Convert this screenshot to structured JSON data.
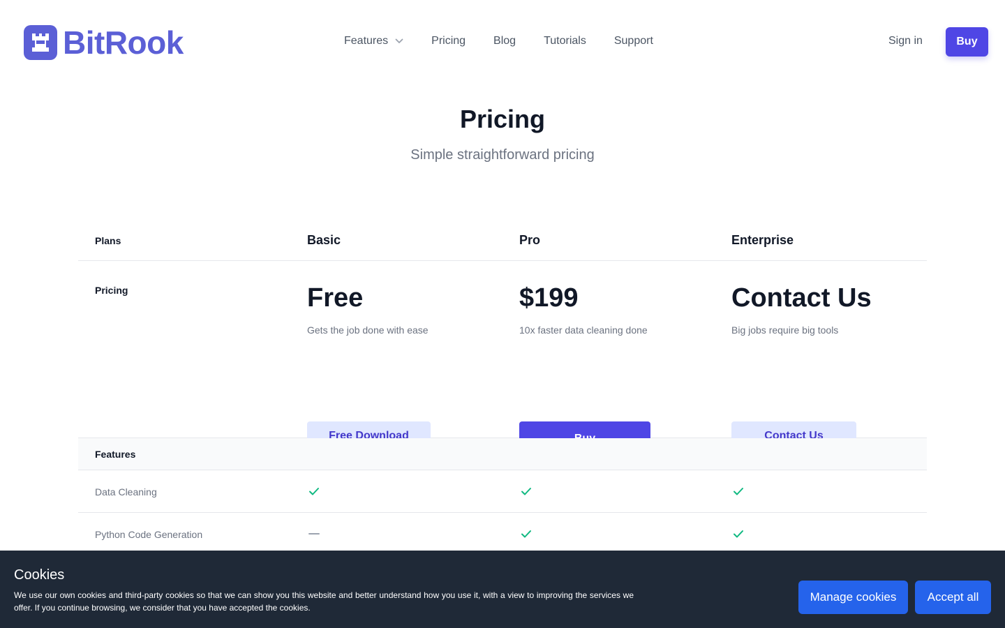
{
  "brand": {
    "name": "BitRook",
    "color": "#5b5fd6",
    "icon": "rook-icon"
  },
  "nav": {
    "items": [
      {
        "label": "Features",
        "has_dropdown": true
      },
      {
        "label": "Pricing"
      },
      {
        "label": "Blog"
      },
      {
        "label": "Tutorials"
      },
      {
        "label": "Support"
      }
    ],
    "sign_in": "Sign in",
    "buy": "Buy"
  },
  "hero": {
    "title": "Pricing",
    "subtitle": "Simple straightforward pricing"
  },
  "table": {
    "plans_label": "Plans",
    "pricing_label": "Pricing",
    "features_label": "Features",
    "plans": [
      {
        "name": "Basic",
        "price": "Free",
        "description": "Gets the job done with ease",
        "cta": "Free Download",
        "cta_style": "light"
      },
      {
        "name": "Pro",
        "price": "$199",
        "description": "10x faster data cleaning done",
        "cta": "Buy",
        "cta_style": "primary"
      },
      {
        "name": "Enterprise",
        "price": "Contact Us",
        "description": "Big jobs require big tools",
        "cta": "Contact Us",
        "cta_style": "light"
      }
    ],
    "features": [
      {
        "name": "Data Cleaning",
        "availability": [
          "check",
          "check",
          "check"
        ]
      },
      {
        "name": "Python Code Generation",
        "availability": [
          "dash",
          "check",
          "check"
        ]
      }
    ]
  },
  "cookie_banner": {
    "title": "Cookies",
    "text": "We use our own cookies and third-party cookies so that we can show you this website and better understand how you use it, with a view to improving the services we offer. If you continue browsing, we consider that you have accepted the cookies.",
    "manage_label": "Manage cookies",
    "accept_label": "Accept all"
  },
  "colors": {
    "primary": "#4f46e5",
    "primary_light": "#e0e7ff",
    "check": "#10b981",
    "banner_bg": "#1f2937",
    "banner_button": "#2563eb"
  }
}
